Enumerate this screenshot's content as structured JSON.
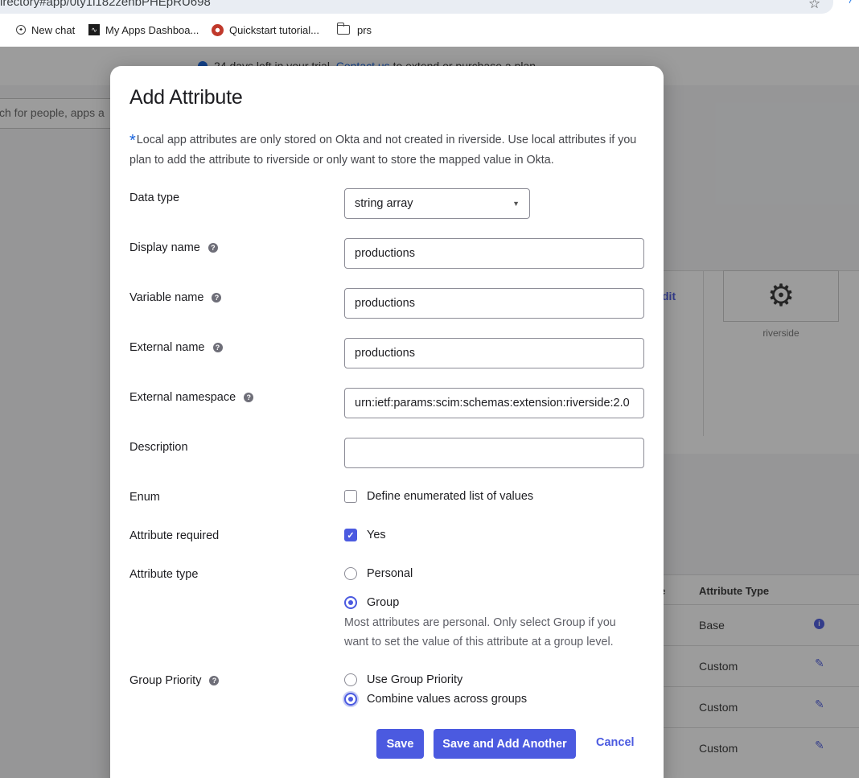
{
  "browser": {
    "url": "irectory#app/0ty1i182zehbPHEpRU698",
    "bookmarks": [
      "New chat",
      "My Apps Dashboa...",
      "Quickstart tutorial...",
      "prs"
    ]
  },
  "background": {
    "trial_text": "24 days left in your trial.",
    "trial_link": "Contact us",
    "trial_suffix": "to extend or purchase a plan",
    "search_placeholder": "ch for people, apps a",
    "edit_label": "dit",
    "app_logo_caption": "riverside",
    "table": {
      "headers": [
        "e",
        "Attribute Type"
      ],
      "rows": [
        {
          "type": "Base",
          "action": "info-icon"
        },
        {
          "type": "Custom",
          "action": "pencil-icon"
        },
        {
          "type": "Custom",
          "action": "pencil-icon"
        },
        {
          "type": "Custom",
          "action": "pencil-icon"
        }
      ]
    }
  },
  "modal": {
    "title": "Add Attribute",
    "note": "Local app attributes are only stored on Okta and not created in riverside. Use local attributes if you plan to add the attribute to riverside or only want to store the mapped value in Okta.",
    "fields": {
      "data_type": {
        "label": "Data type",
        "value": "string array"
      },
      "display_name": {
        "label": "Display name",
        "value": "productions"
      },
      "variable_name": {
        "label": "Variable name",
        "value": "productions"
      },
      "external_name": {
        "label": "External name",
        "value": "productions"
      },
      "external_namespace": {
        "label": "External namespace",
        "value": "urn:ietf:params:scim:schemas:extension:riverside:2.0"
      },
      "description": {
        "label": "Description",
        "value": ""
      }
    },
    "enum": {
      "label": "Enum",
      "option": "Define enumerated list of values",
      "checked": false
    },
    "required": {
      "label": "Attribute required",
      "option": "Yes",
      "checked": true
    },
    "attribute_type": {
      "label": "Attribute type",
      "options": [
        "Personal",
        "Group"
      ],
      "selected": "Group",
      "hint": "Most attributes are personal. Only select Group if you want to set the value of this attribute at a group level."
    },
    "group_priority": {
      "label": "Group Priority",
      "options": [
        "Use Group Priority",
        "Combine values across groups"
      ],
      "selected": "Combine values across groups"
    },
    "buttons": {
      "save": "Save",
      "save_add": "Save and Add Another",
      "cancel": "Cancel"
    },
    "accent_color": "#4b5ae0"
  }
}
